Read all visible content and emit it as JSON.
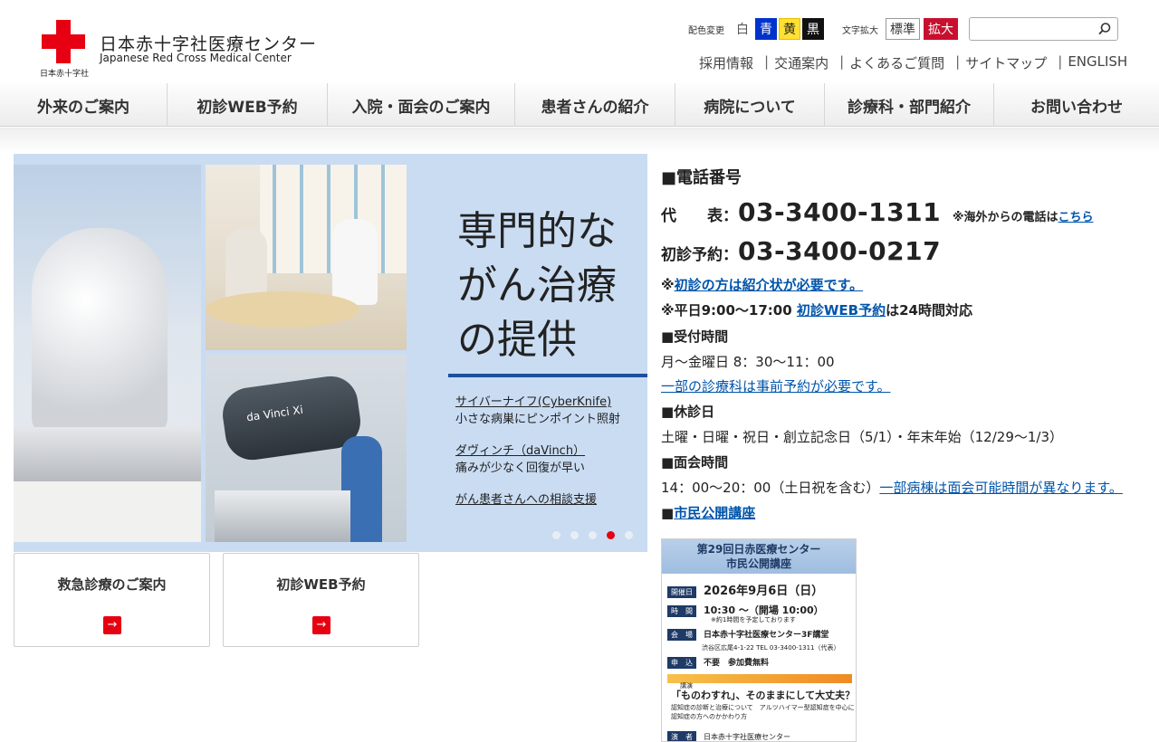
{
  "header": {
    "logo_small": "日本赤十字社",
    "logo_jp": "日本赤十字社医療センター",
    "logo_en": "Japanese Red Cross Medical Center",
    "color_label": "配色変更",
    "colors": [
      "白",
      "青",
      "黄",
      "黒"
    ],
    "font_label": "文字拡大",
    "font_buttons": [
      "標準",
      "拡大"
    ],
    "search_placeholder": "",
    "sublinks": [
      "採用情報",
      "交通案内",
      "よくあるご質問",
      "サイトマップ",
      "ENGLISH"
    ]
  },
  "nav": [
    "外来のご案内",
    "初診WEB予約",
    "入院・面会のご案内",
    "患者さんの紹介",
    "病院について",
    "診療科・部門紹介",
    "お問い合わせ"
  ],
  "hero": {
    "headline": [
      "専門的な",
      "がん治療",
      "の提供"
    ],
    "photo_brand": "da Vinci Xi",
    "features": [
      {
        "title": "サイバーナイフ(CyberKnife)",
        "sub": "小さな病巣にピンポイント照射"
      },
      {
        "title": "ダヴィンチ（daVinch）",
        "sub": "痛みが少なく回復が早い"
      },
      {
        "title": "がん患者さんへの相談支援",
        "sub": ""
      }
    ],
    "slide_count": 5,
    "active_slide": 4
  },
  "cards": [
    {
      "label": "救急診療のご案内",
      "arrow": "→"
    },
    {
      "label": "初診WEB予約",
      "arrow": "→"
    }
  ],
  "info": {
    "phone_heading": "■電話番号",
    "main_label": "代　　表：",
    "main_number": "03-3400-1311",
    "overseas_text": "※海外からの電話は",
    "overseas_link": "こちら",
    "first_label": "初診予約：",
    "first_number": "03-3400-0217",
    "referral_prefix": "※",
    "referral_link": "初診の方は紹介状が必要です。",
    "weekday_prefix": "※平日9:00〜17:00 ",
    "weekday_link": "初診WEB予約",
    "weekday_suffix": "は24時間対応",
    "reception_heading": "■受付時間",
    "reception_hours": "月〜金曜日 8：30〜11：00",
    "reception_link": "一部の診療科は事前予約が必要です。",
    "closed_heading": "■休診日",
    "closed_days": "土曜・日曜・祝日・創立記念日（5/1）・年末年始（12/29〜1/3）",
    "visit_heading": "■面会時間",
    "visit_hours": "14：00〜20：00（土日祝を含む）",
    "visit_link": "一部病棟は面会可能時間が異なります。",
    "lecture_prefix": "■",
    "lecture_link": "市民公開講座"
  },
  "poster": {
    "title1": "第29回日赤医療センター",
    "title2": "市民公開講座",
    "date_tag": "開催日",
    "date": "2026年9月6日（日）",
    "time_tag": "時　間",
    "time": "10:30 〜（開場 10:00）",
    "time_note": "※約1時間を予定しております",
    "venue_tag": "会　場",
    "venue": "日本赤十字社医療センター3F講堂",
    "address": "渋谷区広尾4-1-22  TEL 03-3400-1311（代表）",
    "apply_tag": "申　込",
    "apply": "不要　参加費無料",
    "lecture_tag": "講演",
    "question": "「ものわすれ」、そのままにして大丈夫？",
    "desc1": "認知症の診断と治療について　アルツハイマー型認知症を中心に",
    "desc2": "認知症の方へのかかわり方",
    "speaker_tag": "演　者",
    "speaker": "日本赤十字社医療センター"
  }
}
